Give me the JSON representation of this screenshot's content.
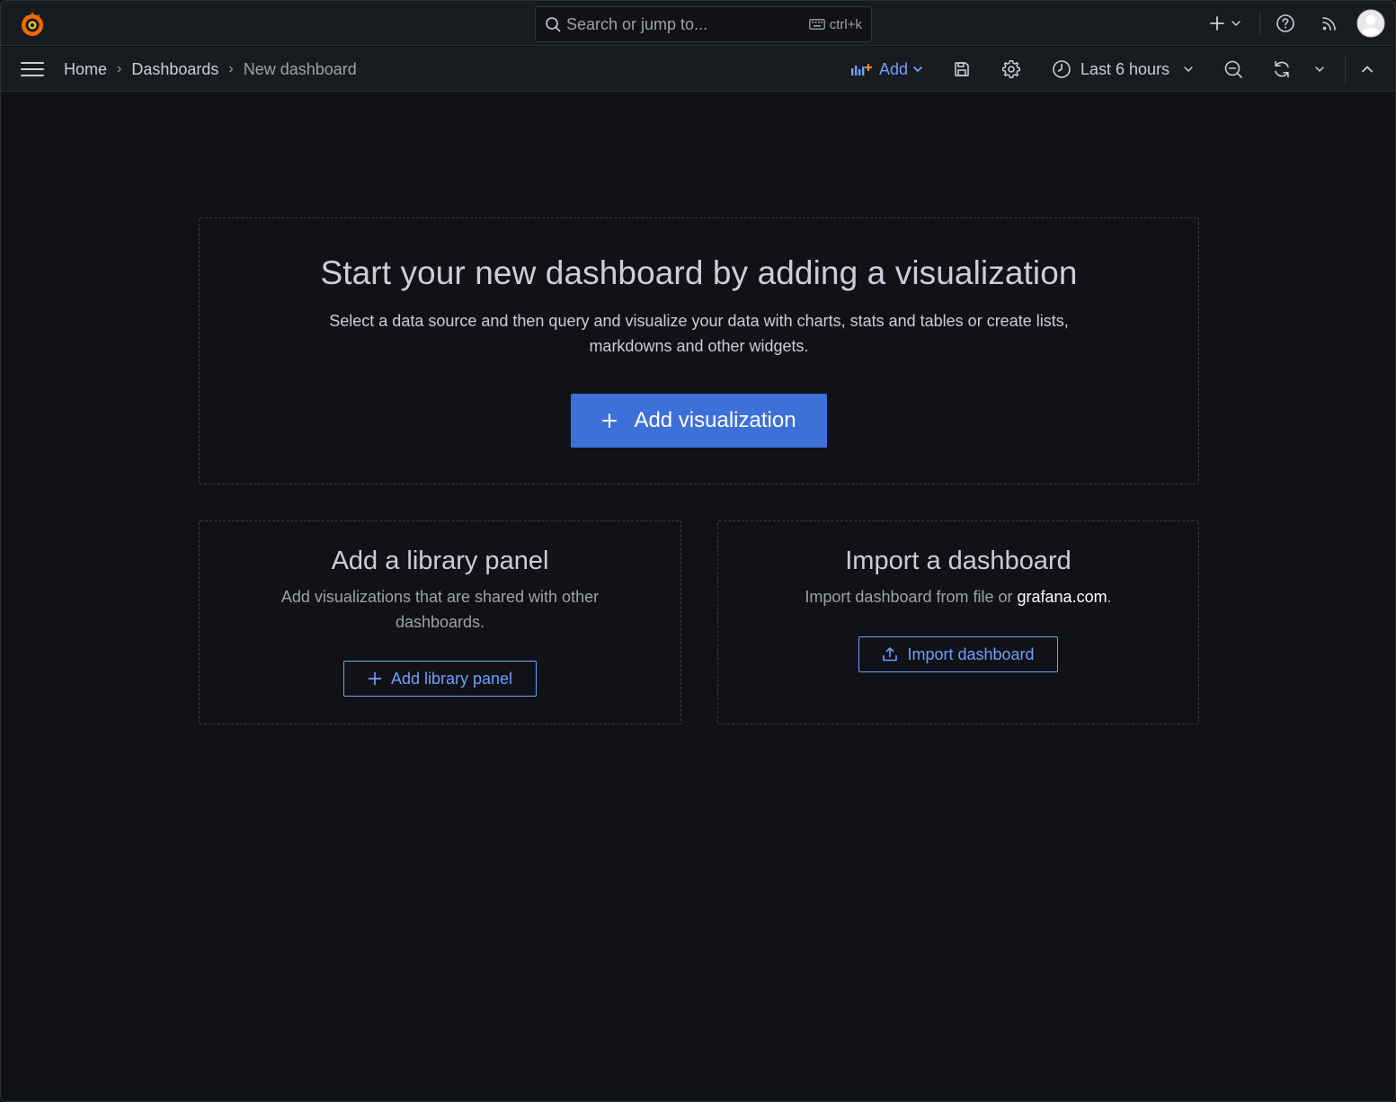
{
  "topbar": {
    "search_placeholder": "Search or jump to...",
    "search_shortcut": "ctrl+k"
  },
  "navbar": {
    "breadcrumb": [
      "Home",
      "Dashboards",
      "New dashboard"
    ],
    "add_label": "Add",
    "time_range": "Last 6 hours"
  },
  "main": {
    "title": "Start your new dashboard by adding a visualization",
    "description": "Select a data source and then query and visualize your data with charts, stats and tables or create lists, markdowns and other widgets.",
    "button_label": "Add visualization"
  },
  "library": {
    "title": "Add a library panel",
    "description": "Add visualizations that are shared with other dashboards.",
    "button_label": "Add library panel"
  },
  "import": {
    "title": "Import a dashboard",
    "description_prefix": "Import dashboard from file or ",
    "description_link": "grafana.com",
    "description_suffix": ".",
    "button_label": "Import dashboard"
  },
  "colors": {
    "background": "#111217",
    "bar": "#181b1f",
    "accent": "#6e9fff",
    "primary": "#3d71d9",
    "logo_orange": "#f46800"
  },
  "icons": [
    "grafana-logo-icon",
    "search-icon",
    "keyboard-icon",
    "plus-icon",
    "help-icon",
    "rss-icon",
    "avatar-icon",
    "hamburger-icon",
    "add-panel-icon",
    "save-icon",
    "gear-icon",
    "clock-icon",
    "zoom-out-icon",
    "refresh-icon",
    "chevron-down-icon",
    "chevron-up-icon",
    "upload-icon"
  ]
}
